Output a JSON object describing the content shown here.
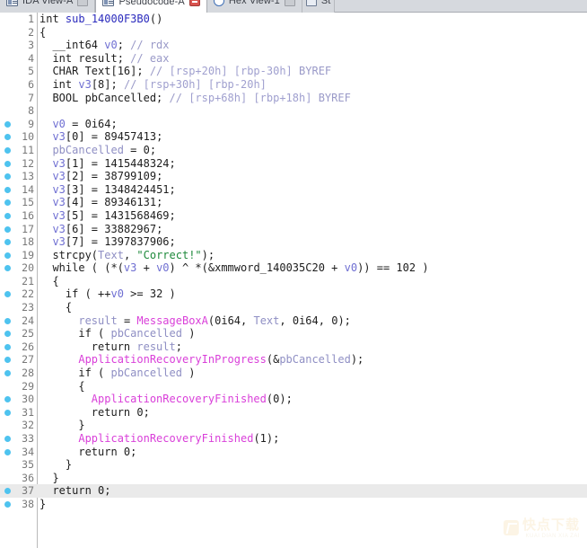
{
  "window": {
    "tabs": [
      {
        "label": "IDA View-A",
        "icon": "document-icon",
        "active": false,
        "close_icon": "minimize-box-icon"
      },
      {
        "label": "Pseudocode-A",
        "icon": "document-icon",
        "active": true,
        "close_icon": "close-icon"
      },
      {
        "label": "Hex View-1",
        "icon": "circle-icon",
        "active": false,
        "close_icon": "minimize-box-icon"
      },
      {
        "label": "St",
        "icon": "chart-icon",
        "active": false,
        "close_icon": ""
      }
    ]
  },
  "editor": {
    "language": "c-pseudocode",
    "current_line": 37,
    "total_lines": 38,
    "lines": [
      {
        "n": 1,
        "bp": false,
        "hl": false,
        "tokens": [
          {
            "t": "int",
            "c": "kw"
          },
          {
            "t": " ",
            "c": "sym"
          },
          {
            "t": "sub_14000F3B0",
            "c": "fn"
          },
          {
            "t": "()",
            "c": "sym"
          }
        ]
      },
      {
        "n": 2,
        "bp": false,
        "hl": false,
        "tokens": [
          {
            "t": "{",
            "c": "sym"
          }
        ]
      },
      {
        "n": 3,
        "bp": false,
        "hl": false,
        "tokens": [
          {
            "t": "  __int64 ",
            "c": "kw"
          },
          {
            "t": "v0",
            "c": "var"
          },
          {
            "t": "; ",
            "c": "sym"
          },
          {
            "t": "// rdx",
            "c": "cmt"
          }
        ]
      },
      {
        "n": 4,
        "bp": false,
        "hl": false,
        "tokens": [
          {
            "t": "  int result; ",
            "c": "kw"
          },
          {
            "t": "// eax",
            "c": "cmt"
          }
        ]
      },
      {
        "n": 5,
        "bp": false,
        "hl": false,
        "tokens": [
          {
            "t": "  CHAR Text[16]; ",
            "c": "kw"
          },
          {
            "t": "// ",
            "c": "cmt"
          },
          {
            "t": "[rsp+20h] [rbp-30h]",
            "c": "loc"
          },
          {
            "t": " BYREF",
            "c": "cmt"
          }
        ]
      },
      {
        "n": 6,
        "bp": false,
        "hl": false,
        "tokens": [
          {
            "t": "  int ",
            "c": "kw"
          },
          {
            "t": "v3",
            "c": "var"
          },
          {
            "t": "[8]; ",
            "c": "sym"
          },
          {
            "t": "// ",
            "c": "cmt"
          },
          {
            "t": "[rsp+30h] [rbp-20h]",
            "c": "loc"
          }
        ]
      },
      {
        "n": 7,
        "bp": false,
        "hl": false,
        "tokens": [
          {
            "t": "  BOOL pbCancelled; ",
            "c": "kw"
          },
          {
            "t": "// ",
            "c": "cmt"
          },
          {
            "t": "[rsp+68h] [rbp+18h]",
            "c": "loc"
          },
          {
            "t": " BYREF",
            "c": "cmt"
          }
        ]
      },
      {
        "n": 8,
        "bp": false,
        "hl": false,
        "tokens": []
      },
      {
        "n": 9,
        "bp": true,
        "hl": false,
        "tokens": [
          {
            "t": "  ",
            "c": "sym"
          },
          {
            "t": "v0",
            "c": "var"
          },
          {
            "t": " = ",
            "c": "sym"
          },
          {
            "t": "0i64",
            "c": "num"
          },
          {
            "t": ";",
            "c": "sym"
          }
        ]
      },
      {
        "n": 10,
        "bp": true,
        "hl": false,
        "tokens": [
          {
            "t": "  ",
            "c": "sym"
          },
          {
            "t": "v3",
            "c": "var"
          },
          {
            "t": "[0] = ",
            "c": "sym"
          },
          {
            "t": "89457413",
            "c": "num"
          },
          {
            "t": ";",
            "c": "sym"
          }
        ]
      },
      {
        "n": 11,
        "bp": true,
        "hl": false,
        "tokens": [
          {
            "t": "  ",
            "c": "sym"
          },
          {
            "t": "pbCancelled",
            "c": "var2"
          },
          {
            "t": " = ",
            "c": "sym"
          },
          {
            "t": "0",
            "c": "num"
          },
          {
            "t": ";",
            "c": "sym"
          }
        ]
      },
      {
        "n": 12,
        "bp": true,
        "hl": false,
        "tokens": [
          {
            "t": "  ",
            "c": "sym"
          },
          {
            "t": "v3",
            "c": "var"
          },
          {
            "t": "[1] = ",
            "c": "sym"
          },
          {
            "t": "1415448324",
            "c": "num"
          },
          {
            "t": ";",
            "c": "sym"
          }
        ]
      },
      {
        "n": 13,
        "bp": true,
        "hl": false,
        "tokens": [
          {
            "t": "  ",
            "c": "sym"
          },
          {
            "t": "v3",
            "c": "var"
          },
          {
            "t": "[2] = ",
            "c": "sym"
          },
          {
            "t": "38799109",
            "c": "num"
          },
          {
            "t": ";",
            "c": "sym"
          }
        ]
      },
      {
        "n": 14,
        "bp": true,
        "hl": false,
        "tokens": [
          {
            "t": "  ",
            "c": "sym"
          },
          {
            "t": "v3",
            "c": "var"
          },
          {
            "t": "[3] = ",
            "c": "sym"
          },
          {
            "t": "1348424451",
            "c": "num"
          },
          {
            "t": ";",
            "c": "sym"
          }
        ]
      },
      {
        "n": 15,
        "bp": true,
        "hl": false,
        "tokens": [
          {
            "t": "  ",
            "c": "sym"
          },
          {
            "t": "v3",
            "c": "var"
          },
          {
            "t": "[4] = ",
            "c": "sym"
          },
          {
            "t": "89346131",
            "c": "num"
          },
          {
            "t": ";",
            "c": "sym"
          }
        ]
      },
      {
        "n": 16,
        "bp": true,
        "hl": false,
        "tokens": [
          {
            "t": "  ",
            "c": "sym"
          },
          {
            "t": "v3",
            "c": "var"
          },
          {
            "t": "[5] = ",
            "c": "sym"
          },
          {
            "t": "1431568469",
            "c": "num"
          },
          {
            "t": ";",
            "c": "sym"
          }
        ]
      },
      {
        "n": 17,
        "bp": true,
        "hl": false,
        "tokens": [
          {
            "t": "  ",
            "c": "sym"
          },
          {
            "t": "v3",
            "c": "var"
          },
          {
            "t": "[6] = ",
            "c": "sym"
          },
          {
            "t": "33882967",
            "c": "num"
          },
          {
            "t": ";",
            "c": "sym"
          }
        ]
      },
      {
        "n": 18,
        "bp": true,
        "hl": false,
        "tokens": [
          {
            "t": "  ",
            "c": "sym"
          },
          {
            "t": "v3",
            "c": "var"
          },
          {
            "t": "[7] = ",
            "c": "sym"
          },
          {
            "t": "1397837906",
            "c": "num"
          },
          {
            "t": ";",
            "c": "sym"
          }
        ]
      },
      {
        "n": 19,
        "bp": true,
        "hl": false,
        "tokens": [
          {
            "t": "  strcpy(",
            "c": "kw"
          },
          {
            "t": "Text",
            "c": "var2"
          },
          {
            "t": ", ",
            "c": "sym"
          },
          {
            "t": "\"Correct!\"",
            "c": "str"
          },
          {
            "t": ");",
            "c": "sym"
          }
        ]
      },
      {
        "n": 20,
        "bp": true,
        "hl": false,
        "tokens": [
          {
            "t": "  while ( (*(",
            "c": "kw"
          },
          {
            "t": "v3",
            "c": "var"
          },
          {
            "t": " + ",
            "c": "sym"
          },
          {
            "t": "v0",
            "c": "var"
          },
          {
            "t": ") ^ *(&",
            "c": "sym"
          },
          {
            "t": "xmmword_140035C20",
            "c": "kw"
          },
          {
            "t": " + ",
            "c": "sym"
          },
          {
            "t": "v0",
            "c": "var"
          },
          {
            "t": ")) == ",
            "c": "sym"
          },
          {
            "t": "102",
            "c": "num"
          },
          {
            "t": " )",
            "c": "sym"
          }
        ]
      },
      {
        "n": 21,
        "bp": false,
        "hl": false,
        "tokens": [
          {
            "t": "  {",
            "c": "sym"
          }
        ]
      },
      {
        "n": 22,
        "bp": true,
        "hl": false,
        "tokens": [
          {
            "t": "    if ( ++",
            "c": "kw"
          },
          {
            "t": "v0",
            "c": "var"
          },
          {
            "t": " >= ",
            "c": "sym"
          },
          {
            "t": "32",
            "c": "num"
          },
          {
            "t": " )",
            "c": "sym"
          }
        ]
      },
      {
        "n": 23,
        "bp": false,
        "hl": false,
        "tokens": [
          {
            "t": "    {",
            "c": "sym"
          }
        ]
      },
      {
        "n": 24,
        "bp": true,
        "hl": false,
        "tokens": [
          {
            "t": "      ",
            "c": "sym"
          },
          {
            "t": "result",
            "c": "var2"
          },
          {
            "t": " = ",
            "c": "sym"
          },
          {
            "t": "MessageBoxA",
            "c": "api"
          },
          {
            "t": "(",
            "c": "sym"
          },
          {
            "t": "0i64",
            "c": "num"
          },
          {
            "t": ", ",
            "c": "sym"
          },
          {
            "t": "Text",
            "c": "var2"
          },
          {
            "t": ", ",
            "c": "sym"
          },
          {
            "t": "0i64",
            "c": "num"
          },
          {
            "t": ", ",
            "c": "sym"
          },
          {
            "t": "0",
            "c": "num"
          },
          {
            "t": ");",
            "c": "sym"
          }
        ]
      },
      {
        "n": 25,
        "bp": true,
        "hl": false,
        "tokens": [
          {
            "t": "      if ( ",
            "c": "kw"
          },
          {
            "t": "pbCancelled",
            "c": "var2"
          },
          {
            "t": " )",
            "c": "sym"
          }
        ]
      },
      {
        "n": 26,
        "bp": true,
        "hl": false,
        "tokens": [
          {
            "t": "        return ",
            "c": "kw"
          },
          {
            "t": "result",
            "c": "var2"
          },
          {
            "t": ";",
            "c": "sym"
          }
        ]
      },
      {
        "n": 27,
        "bp": true,
        "hl": false,
        "tokens": [
          {
            "t": "      ",
            "c": "sym"
          },
          {
            "t": "ApplicationRecoveryInProgress",
            "c": "api"
          },
          {
            "t": "(&",
            "c": "sym"
          },
          {
            "t": "pbCancelled",
            "c": "var2"
          },
          {
            "t": ");",
            "c": "sym"
          }
        ]
      },
      {
        "n": 28,
        "bp": true,
        "hl": false,
        "tokens": [
          {
            "t": "      if ( ",
            "c": "kw"
          },
          {
            "t": "pbCancelled",
            "c": "var2"
          },
          {
            "t": " )",
            "c": "sym"
          }
        ]
      },
      {
        "n": 29,
        "bp": false,
        "hl": false,
        "tokens": [
          {
            "t": "      {",
            "c": "sym"
          }
        ]
      },
      {
        "n": 30,
        "bp": true,
        "hl": false,
        "tokens": [
          {
            "t": "        ",
            "c": "sym"
          },
          {
            "t": "ApplicationRecoveryFinished",
            "c": "api"
          },
          {
            "t": "(",
            "c": "sym"
          },
          {
            "t": "0",
            "c": "num"
          },
          {
            "t": ");",
            "c": "sym"
          }
        ]
      },
      {
        "n": 31,
        "bp": true,
        "hl": false,
        "tokens": [
          {
            "t": "        return ",
            "c": "kw"
          },
          {
            "t": "0",
            "c": "num"
          },
          {
            "t": ";",
            "c": "sym"
          }
        ]
      },
      {
        "n": 32,
        "bp": false,
        "hl": false,
        "tokens": [
          {
            "t": "      }",
            "c": "sym"
          }
        ]
      },
      {
        "n": 33,
        "bp": true,
        "hl": false,
        "tokens": [
          {
            "t": "      ",
            "c": "sym"
          },
          {
            "t": "ApplicationRecoveryFinished",
            "c": "api"
          },
          {
            "t": "(",
            "c": "sym"
          },
          {
            "t": "1",
            "c": "num"
          },
          {
            "t": ");",
            "c": "sym"
          }
        ]
      },
      {
        "n": 34,
        "bp": true,
        "hl": false,
        "tokens": [
          {
            "t": "      return ",
            "c": "kw"
          },
          {
            "t": "0",
            "c": "num"
          },
          {
            "t": ";",
            "c": "sym"
          }
        ]
      },
      {
        "n": 35,
        "bp": false,
        "hl": false,
        "tokens": [
          {
            "t": "    }",
            "c": "sym"
          }
        ]
      },
      {
        "n": 36,
        "bp": false,
        "hl": false,
        "tokens": [
          {
            "t": "  }",
            "c": "sym"
          }
        ]
      },
      {
        "n": 37,
        "bp": true,
        "hl": true,
        "tokens": [
          {
            "t": "  return ",
            "c": "kw"
          },
          {
            "t": "0",
            "c": "num"
          },
          {
            "t": ";",
            "c": "sym"
          }
        ]
      },
      {
        "n": 38,
        "bp": true,
        "hl": false,
        "tokens": [
          {
            "t": "}",
            "c": "sym"
          }
        ]
      }
    ]
  },
  "watermark": {
    "logo": "kuaidianxiazai-logo",
    "text": "快点下载",
    "subtext": "KUAI DIAN XIA ZAI"
  },
  "colors": {
    "background": "#ffffff",
    "tabbar": "#d6d9de",
    "gutter_line": "#b9b9b9",
    "line_number": "#787878",
    "breakpoint": "#4ec3ef",
    "current_line_highlight": "#eaeaea",
    "keyword": "#1d1d1d",
    "variable": "#6f6fd2",
    "variable_alt": "#8f8fc4",
    "string": "#1f8a3c",
    "comment": "#9a9ac8",
    "api_function": "#d93fd9",
    "function_name": "#2b2bbd",
    "stack_location": "#a0a0cf"
  }
}
